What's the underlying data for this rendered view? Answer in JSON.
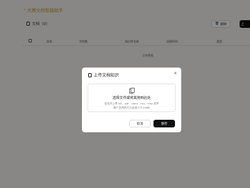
{
  "header": {
    "back_label": "大赛文档智能助手"
  },
  "docs": {
    "title": "文档（0）",
    "delete_label": "删除",
    "upload_label": "上"
  },
  "table": {
    "columns": [
      "状态",
      "字符数",
      "知识库名称",
      "创建时间",
      "类型"
    ],
    "empty_text": "没有数据"
  },
  "modal": {
    "title": "上传文档知识",
    "dropzone_title": "选择文件或将其拖到此处",
    "hint_line1": "仅允许上传 txt、pdf、docx、csv、xlsx 文件",
    "hint_line2": "每个文件的大小必须小于15MB",
    "cancel_label": "取消",
    "save_label": "保存"
  }
}
